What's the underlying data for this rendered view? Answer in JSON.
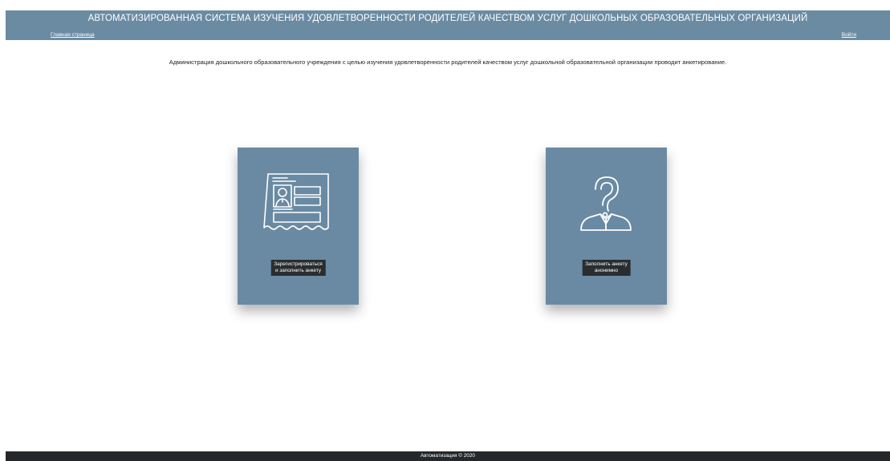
{
  "header": {
    "title": "АВТОМАТИЗИРОВАННАЯ СИСТЕМА ИЗУЧЕНИЯ УДОВЛЕТВОРЕННОСТИ РОДИТЕЛЕЙ КАЧЕСТВОМ УСЛУГ ДОШКОЛЬНЫХ ОБРАЗОВАТЕЛЬНЫХ ОРГАНИЗАЦИЙ",
    "home_link": "Главная страница",
    "login_link": "Войти"
  },
  "intro": {
    "text": "Администрация дошкольного образовательного учреждения с целью изучения удовлетворенности родителей качеством услуг дошкольной образовательной организации проводит анкетирование."
  },
  "cards": [
    {
      "icon": "id-card-form-icon",
      "button_label": "Зарегистрироваться\nи заполнить анкету"
    },
    {
      "icon": "anonymous-person-question-icon",
      "button_label": "Заполнить анкету\nанонимно"
    }
  ],
  "footer": {
    "text": "Автоматизация © 2020"
  },
  "colors": {
    "header_bg": "#6b8ba3",
    "card_bg": "#6a8aa3",
    "button_bg": "#2a2d30",
    "footer_bg": "#25282b"
  }
}
